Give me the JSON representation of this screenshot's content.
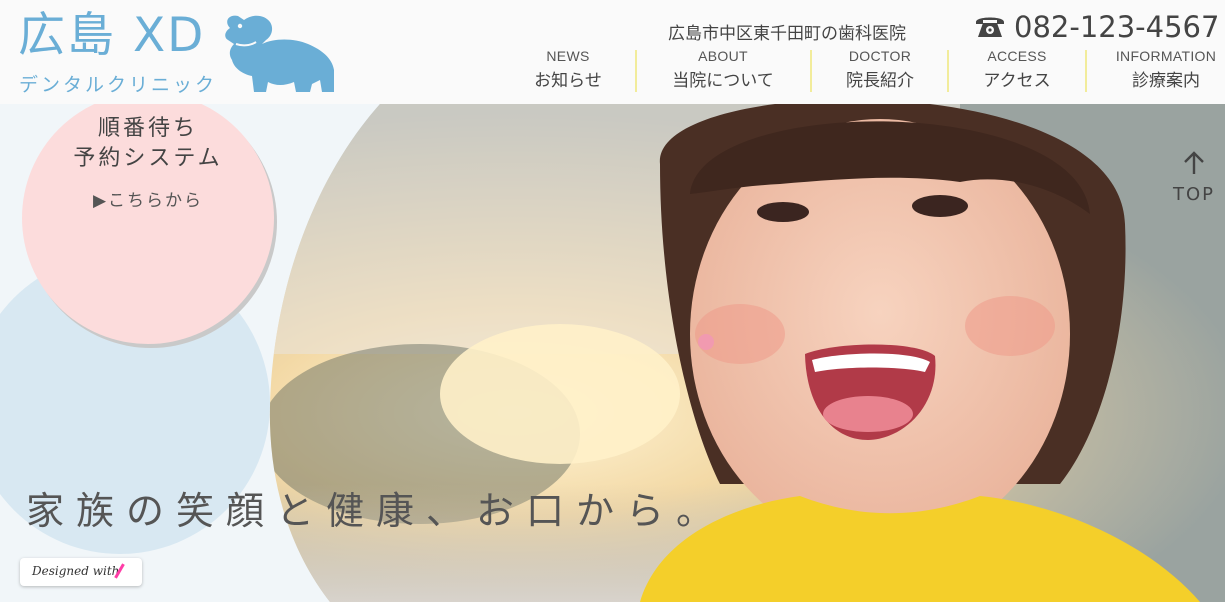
{
  "header": {
    "logo_title": "広島 XD",
    "logo_subtitle": "デンタルクリニック",
    "address": "広島市中区東千田町の歯科医院",
    "phone": "082-123-4567",
    "brand_color": "#6aaed6"
  },
  "nav": [
    {
      "en": "NEWS",
      "jp": "お知らせ"
    },
    {
      "en": "ABOUT",
      "jp": "当院について"
    },
    {
      "en": "DOCTOR",
      "jp": "院長紹介"
    },
    {
      "en": "ACCESS",
      "jp": "アクセス"
    },
    {
      "en": "INFORMATION",
      "jp": "診療案内"
    }
  ],
  "hero": {
    "reserve_line1": "順番待ち",
    "reserve_line2": "予約システム",
    "reserve_link": "▶こちらから",
    "top_label": "TOP",
    "tagline": "家族の笑顔と健康、お口から。",
    "badge_text": "Designed with"
  },
  "colors": {
    "reserve_bg": "#fcdcdc",
    "nav_separator": "#f2ec9b",
    "shirt": "#f4cf2a"
  },
  "icons": {
    "logo": "hippo-icon",
    "phone": "phone-icon",
    "top": "arrow-up-icon"
  }
}
